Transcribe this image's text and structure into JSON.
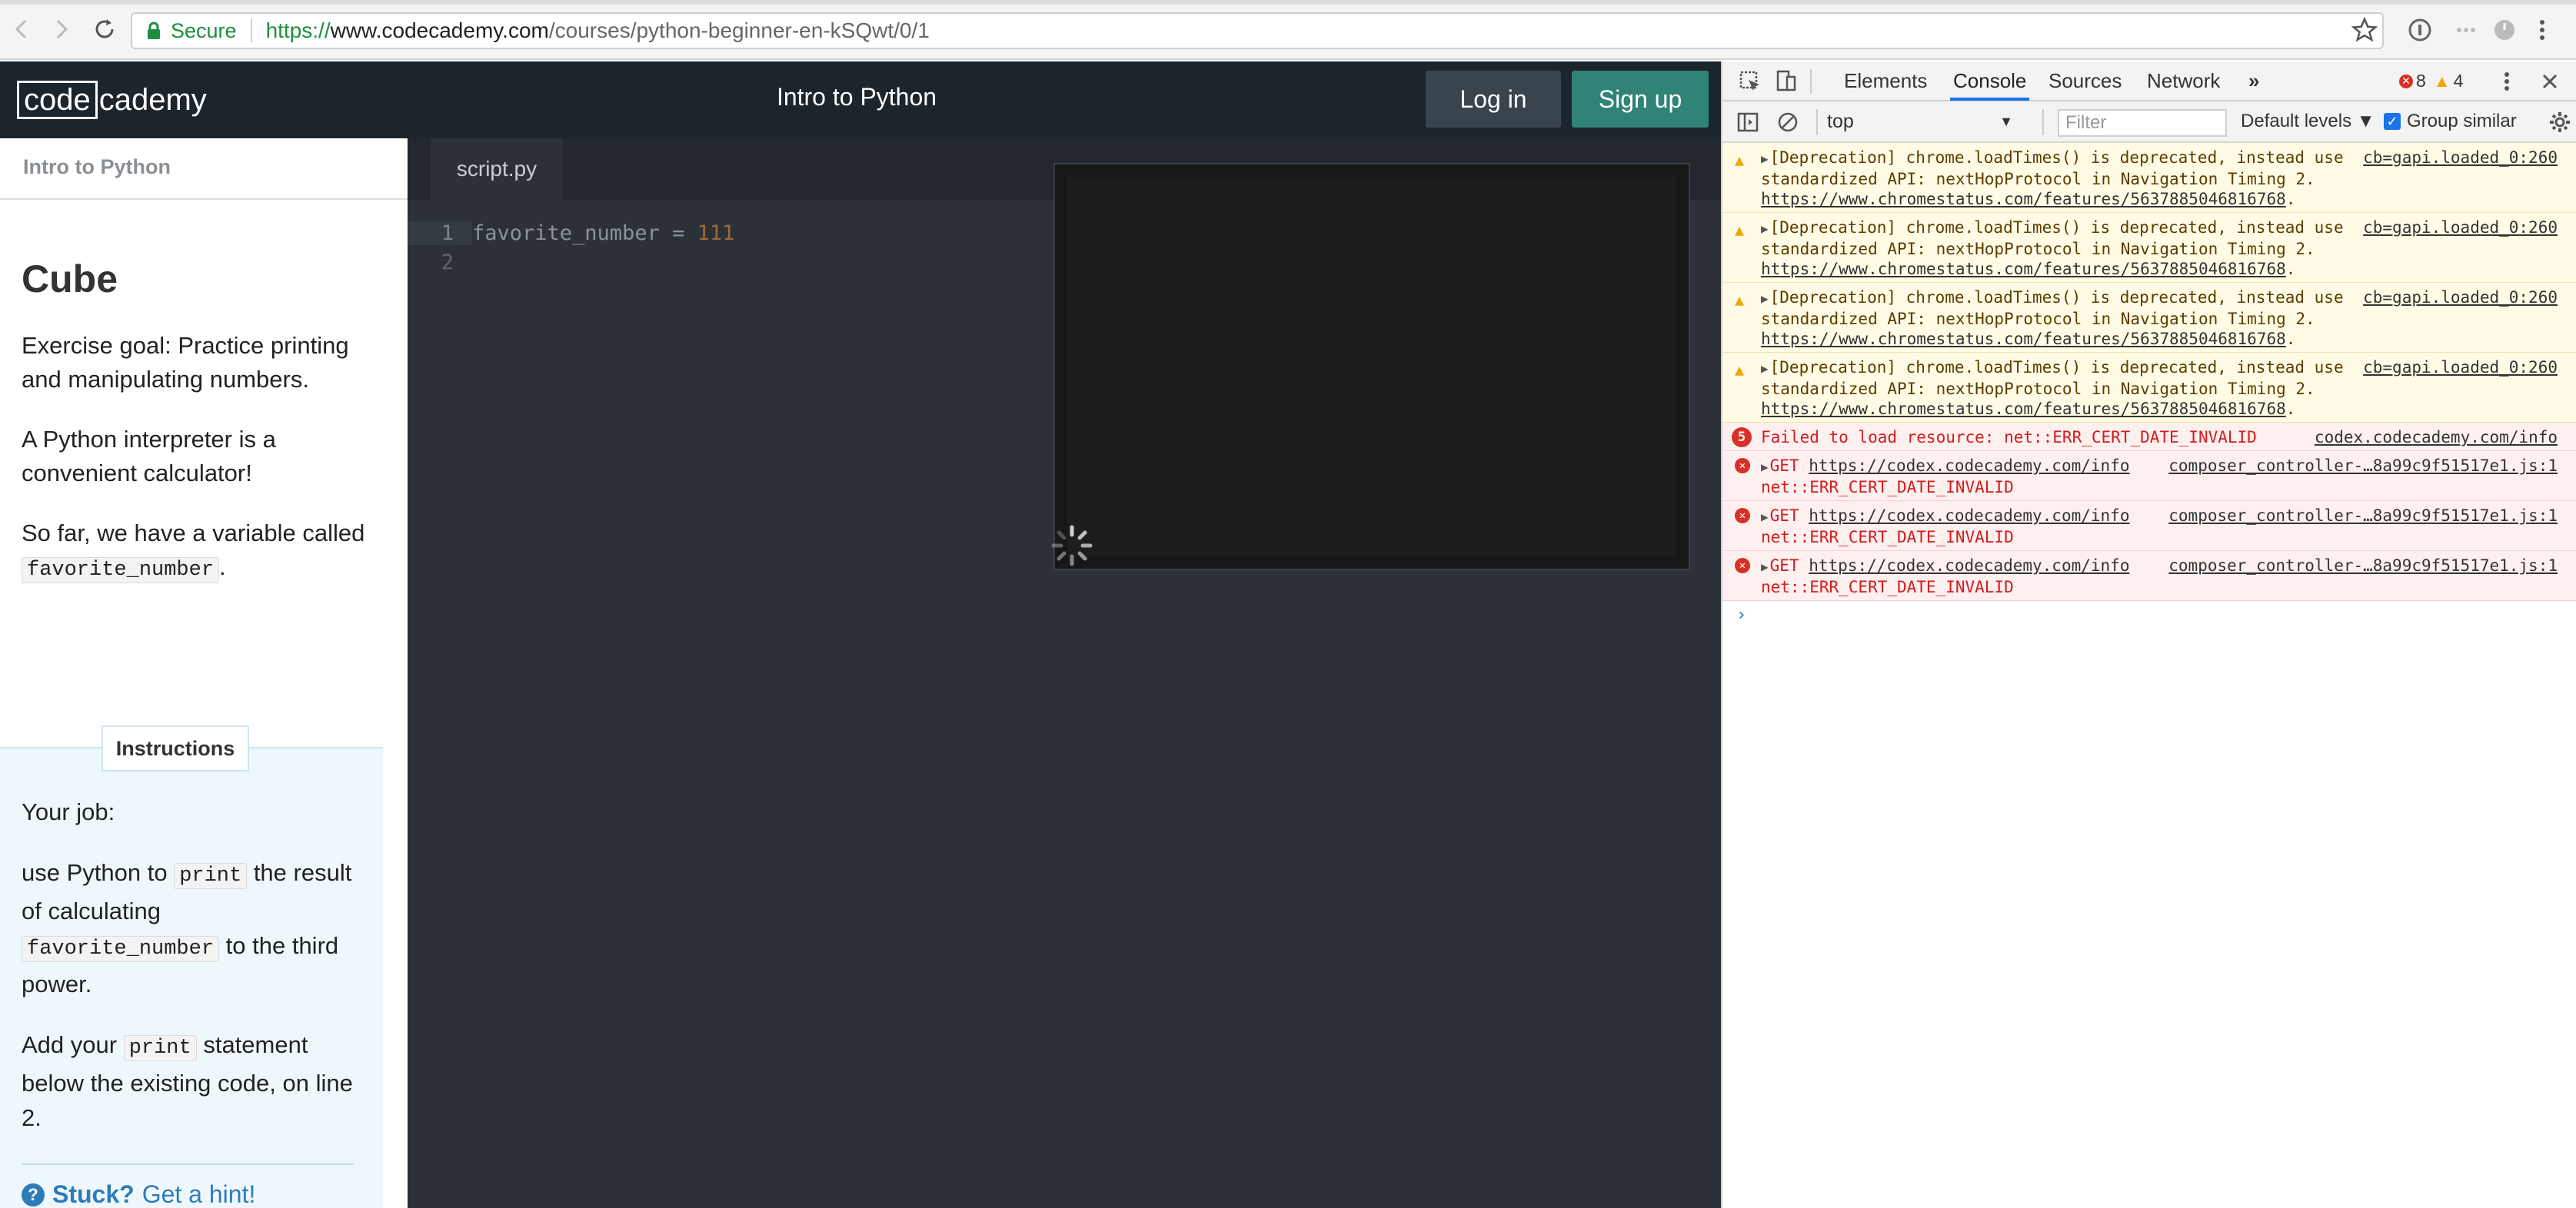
{
  "browser": {
    "secure_label": "Secure",
    "url_scheme": "https://",
    "url_host": "www.codecademy.com",
    "url_path": "/courses/python-beginner-en-kSQwt/0/1"
  },
  "header": {
    "logo_box": "code",
    "logo_rest": "cademy",
    "course_title": "Intro to Python",
    "login_label": "Log in",
    "signup_label": "Sign up"
  },
  "lesson": {
    "breadcrumb": "Intro to Python",
    "title": "Cube",
    "p1": "Exercise goal: Practice printing and manipulating numbers.",
    "p2": "A Python interpreter is a convenient calculator!",
    "p3_before": "So far, we have a variable called ",
    "p3_code": "favorite_number",
    "p3_after": "."
  },
  "instructions": {
    "tab_label": "Instructions",
    "job": "Your job:",
    "i1_a": "use Python to ",
    "i1_code1": "print",
    "i1_b": " the result of calculating ",
    "i1_code2": "favorite_number",
    "i1_c": " to the third power.",
    "i2_a": "Add your ",
    "i2_code": "print",
    "i2_b": " statement below the existing code, on line 2.",
    "stuck": "Stuck?",
    "hint": "Get a hint!"
  },
  "editor": {
    "file_tab": "script.py",
    "lines": [
      {
        "num": "1",
        "var": "favorite_number",
        "op": " = ",
        "num_val": "111"
      },
      {
        "num": "2",
        "var": "",
        "op": "",
        "num_val": ""
      }
    ]
  },
  "devtools": {
    "tabs": [
      "Elements",
      "Console",
      "Sources",
      "Network"
    ],
    "active_tab": "Console",
    "more": "»",
    "error_count": "8",
    "warning_count": "4",
    "context": "top",
    "filter_placeholder": "Filter",
    "levels": "Default levels ▼",
    "group_similar": "Group similar",
    "messages": [
      {
        "type": "warn",
        "text": "[Deprecation] chrome.loadTimes() is deprecated, instead use standardized API: nextHopProtocol in Navigation Timing 2. ",
        "link": "https://www.chromestatus.com/features/5637885046816768",
        "src": "cb=gapi.loaded_0:260"
      },
      {
        "type": "warn",
        "text": "[Deprecation] chrome.loadTimes() is deprecated, instead use standardized API: nextHopProtocol in Navigation Timing 2. ",
        "link": "https://www.chromestatus.com/features/5637885046816768",
        "src": "cb=gapi.loaded_0:260"
      },
      {
        "type": "warn",
        "text": "[Deprecation] chrome.loadTimes() is deprecated, instead use standardized API: nextHopProtocol in Navigation Timing 2. ",
        "link": "https://www.chromestatus.com/features/5637885046816768",
        "src": "cb=gapi.loaded_0:260"
      },
      {
        "type": "warn",
        "text": "[Deprecation] chrome.loadTimes() is deprecated, instead use standardized API: nextHopProtocol in Navigation Timing 2. ",
        "link": "https://www.chromestatus.com/features/5637885046816768",
        "src": "cb=gapi.loaded_0:260"
      }
    ],
    "failed": {
      "count": "5",
      "text": "Failed to load resource: net::ERR_CERT_DATE_INVALID",
      "src": "codex.codecademy.com/info"
    },
    "gets": [
      {
        "method": "GET",
        "url": "https://codex.codecademy.com/info",
        "err": "net::ERR_CERT_DATE_INVALID",
        "src": "composer_controller-…8a99c9f51517e1.js:1"
      },
      {
        "method": "GET",
        "url": "https://codex.codecademy.com/info",
        "err": "net::ERR_CERT_DATE_INVALID",
        "src": "composer_controller-…8a99c9f51517e1.js:1"
      },
      {
        "method": "GET",
        "url": "https://codex.codecademy.com/info",
        "err": "net::ERR_CERT_DATE_INVALID",
        "src": "composer_controller-…8a99c9f51517e1.js:1"
      }
    ],
    "prompt": "›"
  },
  "colors": {
    "header_bg": "#1c252c",
    "editor_bg": "#2b3137",
    "signup": "#2f8377",
    "link_blue": "#2d7cb8"
  }
}
